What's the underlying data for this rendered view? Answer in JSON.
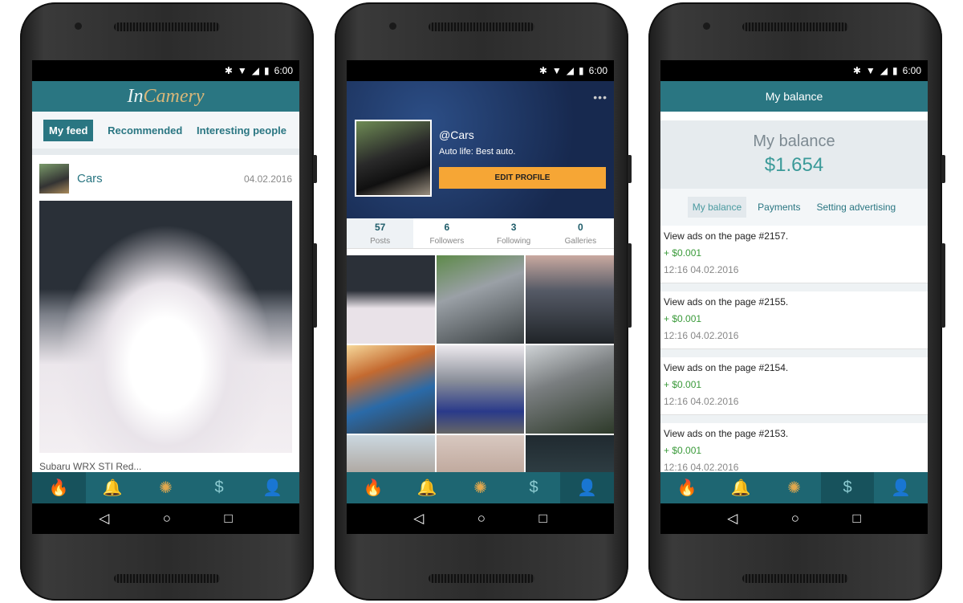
{
  "status": {
    "time": "6:00",
    "icons": [
      "bluetooth-icon",
      "wifi-icon",
      "signal-icon",
      "battery-icon"
    ]
  },
  "bottom_nav": [
    {
      "icon": "flame-icon",
      "glyph": "🔥"
    },
    {
      "icon": "bell-icon",
      "glyph": "🔔"
    },
    {
      "icon": "aperture-icon",
      "glyph": "✺"
    },
    {
      "icon": "dollar-icon",
      "glyph": "$"
    },
    {
      "icon": "user-icon",
      "glyph": "👤"
    }
  ],
  "feed": {
    "logo_a": "In",
    "logo_b": "Camery",
    "tabs": [
      "My feed",
      "Recommended",
      "Interesting people"
    ],
    "post": {
      "author": "Cars",
      "date": "04.02.2016",
      "caption": "Subaru WRX STI Red..."
    },
    "active_nav": 0
  },
  "profile": {
    "handle": "@Cars",
    "bio": "Auto life: Best auto.",
    "edit_label": "EDIT PROFILE",
    "more": "•••",
    "stats": [
      {
        "value": "57",
        "label": "Posts"
      },
      {
        "value": "6",
        "label": "Followers"
      },
      {
        "value": "3",
        "label": "Following"
      },
      {
        "value": "0",
        "label": "Galleries"
      }
    ],
    "active_nav": 4
  },
  "balance": {
    "title": "My balance",
    "heading": "My balance",
    "amount": "$1.654",
    "tabs": [
      "My balance",
      "Payments",
      "Setting advertising"
    ],
    "active_nav": 3,
    "items": [
      {
        "text": "View ads on the page #2157.",
        "amount": "+ $0.001",
        "time": "12:16 04.02.2016"
      },
      {
        "text": "View ads on the page #2155.",
        "amount": "+ $0.001",
        "time": "12:16 04.02.2016"
      },
      {
        "text": "View ads on the page #2154.",
        "amount": "+ $0.001",
        "time": "12:16 04.02.2016"
      },
      {
        "text": "View ads on the page #2153.",
        "amount": "+ $0.001",
        "time": "12:16 04.02.2016"
      }
    ]
  },
  "colors": {
    "primary": "#2a7682",
    "nav": "#1e6672",
    "accent": "#f6a635",
    "positive": "#3a9a3a"
  }
}
